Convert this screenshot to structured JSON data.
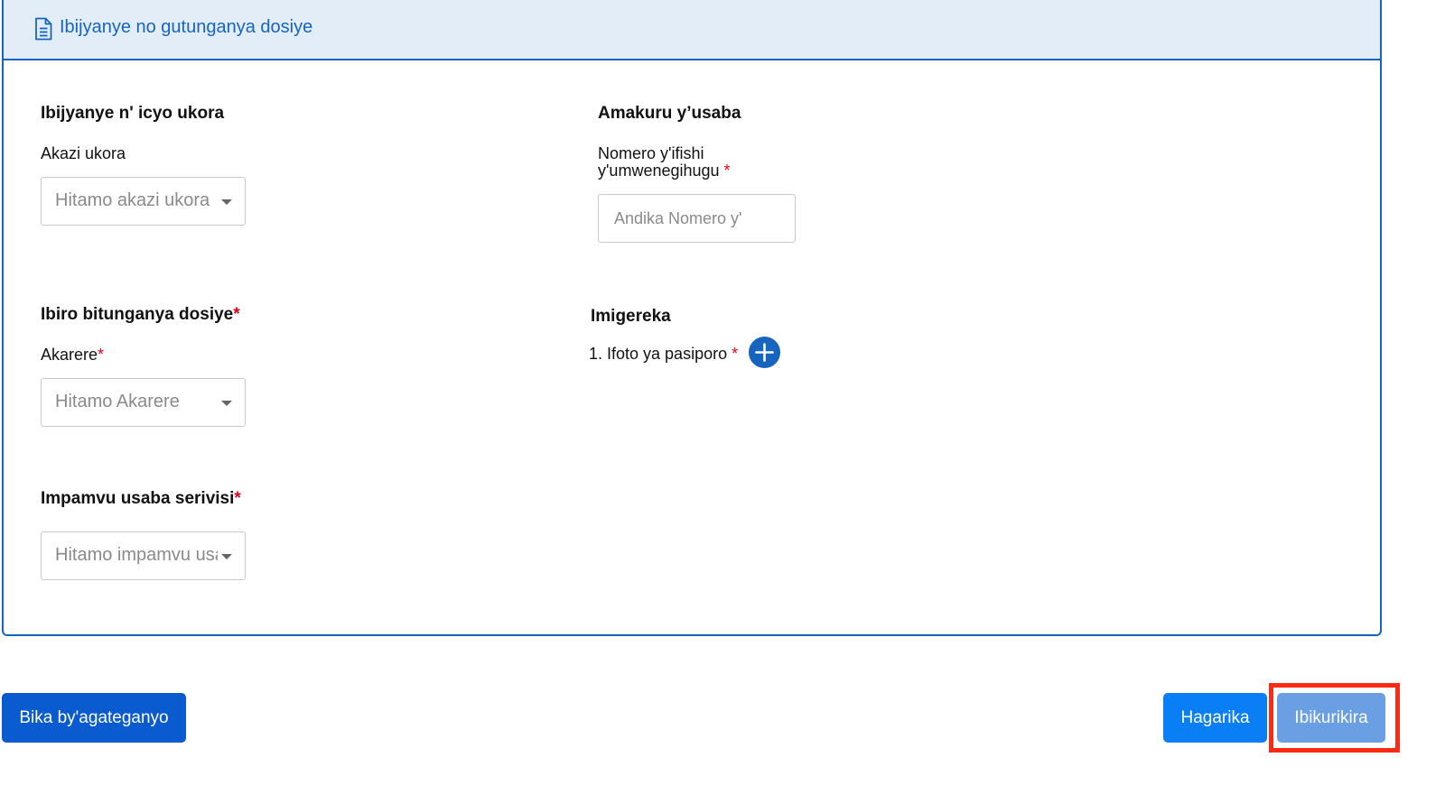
{
  "header": {
    "title": "Ibijyanye no gutunganya dosiye",
    "icon": "document-icon"
  },
  "job_section": {
    "title": "Ibijyanye n' icyo ukora",
    "job_label": "Akazi ukora",
    "job_placeholder": "Hitamo akazi ukora"
  },
  "applicant_section": {
    "title": "Amakuru y’usaba",
    "id_label_line1": "Nomero y'ifishi",
    "id_label_line2": "y'umwenegihugu",
    "required_mark": "*",
    "id_placeholder": "Andika Nomero y'"
  },
  "office_section": {
    "title": "Ibiro bitunganya dosiye",
    "required_mark": "*",
    "district_label": "Akarere",
    "district_placeholder": "Hitamo Akarere"
  },
  "attachments_section": {
    "title": "Imigereka",
    "items": [
      {
        "label": "1. Ifoto ya pasiporo",
        "required_mark": "*"
      }
    ]
  },
  "reason_section": {
    "title": "Impamvu usaba serivisi",
    "required_mark": "*",
    "reason_placeholder": "Hitamo impamvu usaba serivisi"
  },
  "actions": {
    "save_draft": "Bika by'agateganyo",
    "cancel": "Hagarika",
    "submit": "Ibikurikira"
  },
  "colors": {
    "primary": "#1565c0",
    "header_bg": "#e3edf8",
    "required": "#e0001b",
    "highlight": "#ff2a14"
  }
}
